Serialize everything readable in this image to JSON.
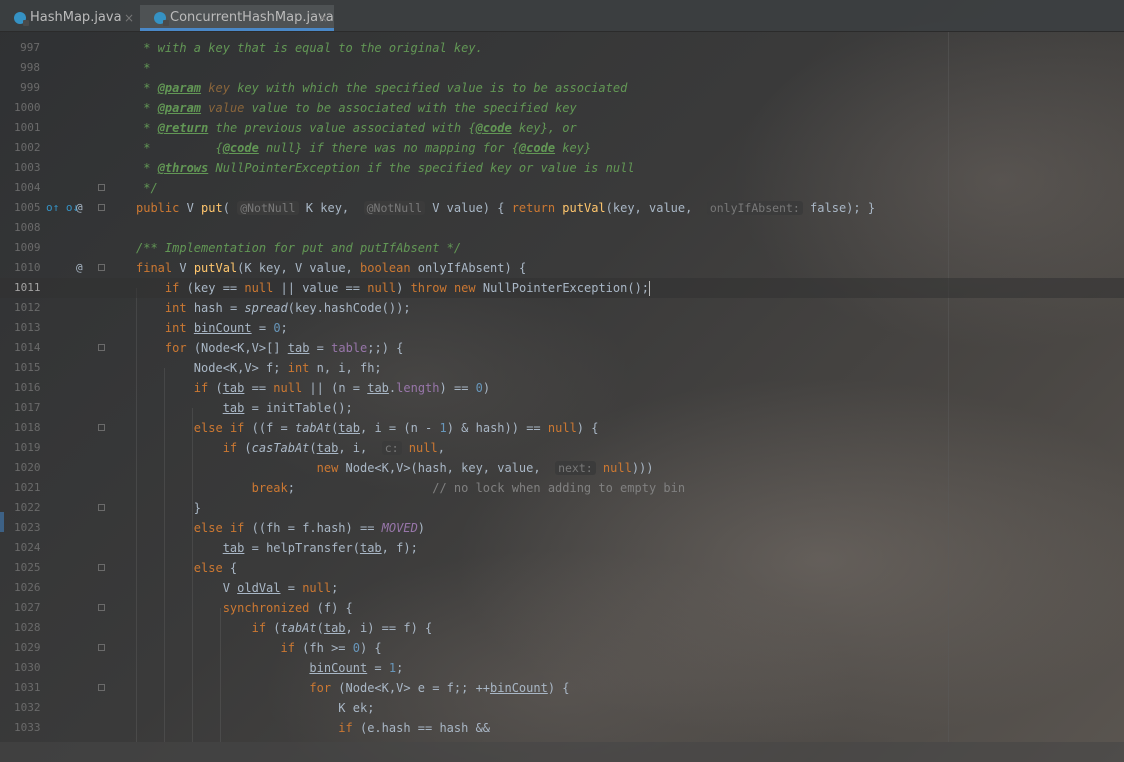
{
  "tabs": [
    {
      "name": "HashMap.java",
      "active": false
    },
    {
      "name": "ConcurrentHashMap.java",
      "active": true
    }
  ],
  "close_glyph": "×",
  "gutter_icons": {
    "override_marker": "o↑ o↓",
    "annotation_marker": "@"
  },
  "lines": [
    {
      "n": "997",
      "text": " * with a key that is equal to the original key."
    },
    {
      "n": "998",
      "text": " *"
    },
    {
      "n": "999",
      "text": " * @param key key with which the specified value is to be associated"
    },
    {
      "n": "1000",
      "text": " * @param value value to be associated with the specified key"
    },
    {
      "n": "1001",
      "text": " * @return the previous value associated with {@code key}, or"
    },
    {
      "n": "1002",
      "text": " *         {@code null} if there was no mapping for {@code key}"
    },
    {
      "n": "1003",
      "text": " * @throws NullPointerException if the specified key or value is null"
    },
    {
      "n": "1004",
      "text": " */"
    },
    {
      "n": "1005",
      "text": "public V put( @NotNull K key,  @NotNull V value) { return putVal(key, value,  onlyIfAbsent: false); }"
    },
    {
      "n": "1008",
      "text": ""
    },
    {
      "n": "1009",
      "text": "/** Implementation for put and putIfAbsent */"
    },
    {
      "n": "1010",
      "text": "final V putVal(K key, V value, boolean onlyIfAbsent) {"
    },
    {
      "n": "1011",
      "text": "    if (key == null || value == null) throw new NullPointerException();"
    },
    {
      "n": "1012",
      "text": "    int hash = spread(key.hashCode());"
    },
    {
      "n": "1013",
      "text": "    int binCount = 0;"
    },
    {
      "n": "1014",
      "text": "    for (Node<K,V>[] tab = table;;) {"
    },
    {
      "n": "1015",
      "text": "        Node<K,V> f; int n, i, fh;"
    },
    {
      "n": "1016",
      "text": "        if (tab == null || (n = tab.length) == 0)"
    },
    {
      "n": "1017",
      "text": "            tab = initTable();"
    },
    {
      "n": "1018",
      "text": "        else if ((f = tabAt(tab, i = (n - 1) & hash)) == null) {"
    },
    {
      "n": "1019",
      "text": "            if (casTabAt(tab, i,  c: null,"
    },
    {
      "n": "1020",
      "text": "                         new Node<K,V>(hash, key, value,  next: null)))"
    },
    {
      "n": "1021",
      "text": "                break;                   // no lock when adding to empty bin"
    },
    {
      "n": "1022",
      "text": "        }"
    },
    {
      "n": "1023",
      "text": "        else if ((fh = f.hash) == MOVED)"
    },
    {
      "n": "1024",
      "text": "            tab = helpTransfer(tab, f);"
    },
    {
      "n": "1025",
      "text": "        else {"
    },
    {
      "n": "1026",
      "text": "            V oldVal = null;"
    },
    {
      "n": "1027",
      "text": "            synchronized (f) {"
    },
    {
      "n": "1028",
      "text": "                if (tabAt(tab, i) == f) {"
    },
    {
      "n": "1029",
      "text": "                    if (fh >= 0) {"
    },
    {
      "n": "1030",
      "text": "                        binCount = 1;"
    },
    {
      "n": "1031",
      "text": "                        for (Node<K,V> e = f;; ++binCount) {"
    },
    {
      "n": "1032",
      "text": "                            K ek;"
    },
    {
      "n": "1033",
      "text": "                            if (e.hash == hash &&"
    }
  ],
  "current_line": "1011",
  "colors": {
    "keyword": "#cc7832",
    "comment": "#629755",
    "number": "#6897bb",
    "method_decl": "#ffc66d",
    "field": "#9876aa",
    "default_text": "#a9b7c6"
  }
}
